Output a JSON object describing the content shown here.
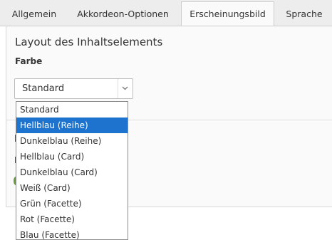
{
  "tabs": [
    {
      "label": "Allgemein"
    },
    {
      "label": "Akkordeon-Optionen"
    },
    {
      "label": "Erscheinungsbild"
    },
    {
      "label": "Sprache"
    }
  ],
  "active_tab_index": 2,
  "section": {
    "title": "Layout des Inhaltselements",
    "field_label": "Farbe"
  },
  "select": {
    "value": "Standard",
    "icon": "chevron-down-icon"
  },
  "dropdown": {
    "options": [
      "Standard",
      "Hellblau (Reihe)",
      "Dunkelblau (Reihe)",
      "Hellblau (Card)",
      "Dunkelblau (Card)",
      "Weiß (Card)",
      "Grün (Facette)",
      "Rot (Facette)",
      "Blau (Facette)"
    ],
    "highlighted_index": 1
  },
  "colors": {
    "highlight": "#1e73ce",
    "panel_bg": "#fafafa",
    "tabbar_bg": "#ededed"
  }
}
